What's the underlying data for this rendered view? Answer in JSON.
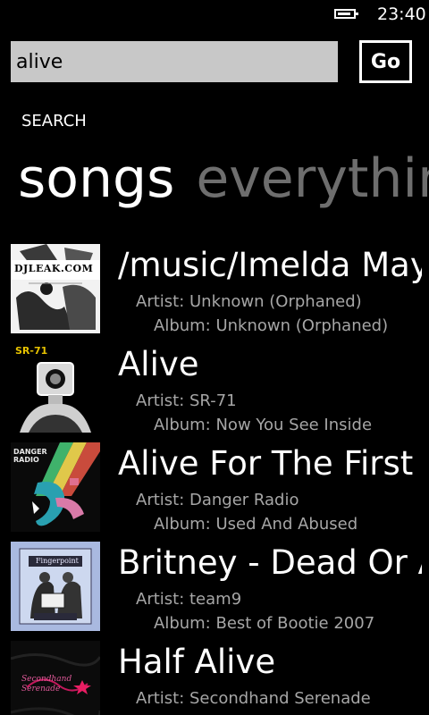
{
  "status_bar": {
    "time": "23:40",
    "battery_icon": "battery-icon"
  },
  "search": {
    "query": "alive",
    "go_label": "Go"
  },
  "section_title": "SEARCH",
  "pivot": {
    "tabs": [
      {
        "label": "songs",
        "active": true
      },
      {
        "label": "everything",
        "active": false
      }
    ]
  },
  "songs": [
    {
      "title": "/music/Imelda May",
      "artist": "Artist: Unknown (Orphaned)",
      "album": "Album: Unknown (Orphaned)",
      "art_text": "DJLEAK.COM"
    },
    {
      "title": "Alive",
      "artist": "Artist: SR-71",
      "album": "Album: Now You See Inside",
      "art_text": "SR-71"
    },
    {
      "title": "Alive For The First",
      "artist": "Artist: Danger Radio",
      "album": "Album: Used And Abused",
      "art_text": "DANGER RADIO"
    },
    {
      "title": "Britney - Dead Or Alive",
      "artist": "Artist: team9",
      "album": "Album: Best of Bootie 2007",
      "art_text": "Fingerpoint"
    },
    {
      "title": "Half Alive",
      "artist": "Artist: Secondhand Serenade",
      "album": "",
      "art_text": "Secondhand Serenade"
    }
  ],
  "colors": {
    "background": "#000000",
    "text": "#ffffff",
    "secondary_text": "#a6a6a6",
    "inactive_pivot": "#6e6e6e",
    "search_box": "#c8c8c8"
  }
}
